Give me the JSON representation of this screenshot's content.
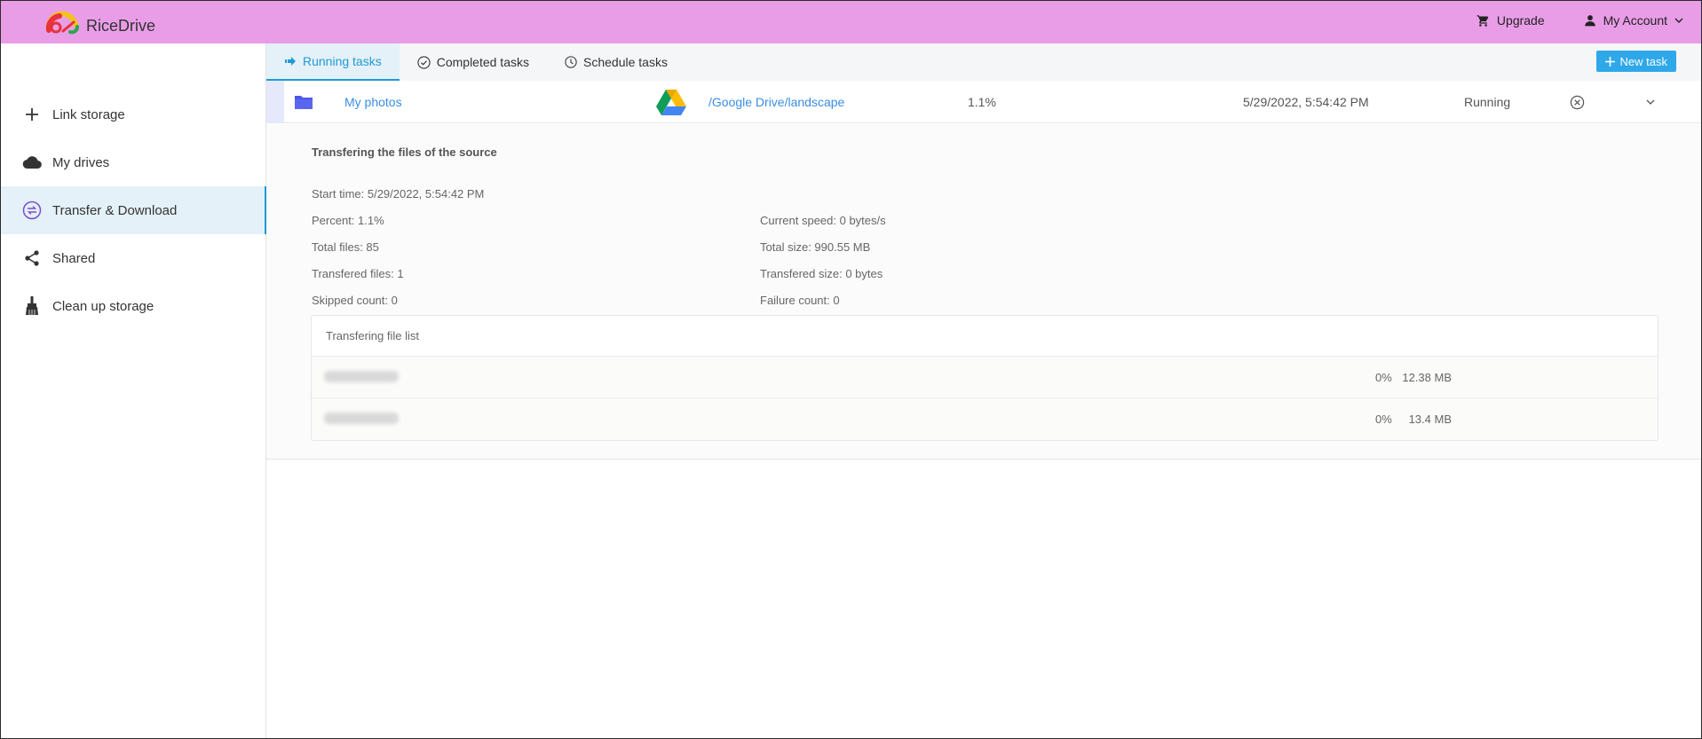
{
  "header": {
    "app_name": "RiceDrive",
    "upgrade_label": "Upgrade",
    "account_label": "My Account",
    "bg_color": "#e99de7"
  },
  "sidebar": {
    "items": [
      {
        "label": "Link storage",
        "icon": "plus-icon"
      },
      {
        "label": "My drives",
        "icon": "cloud-icon"
      },
      {
        "label": "Transfer & Download",
        "icon": "transfer-icon",
        "active": true
      },
      {
        "label": "Shared",
        "icon": "share-icon"
      },
      {
        "label": "Clean up storage",
        "icon": "broom-icon"
      }
    ]
  },
  "tabs": [
    {
      "label": "Running tasks",
      "icon": "arrow-right-icon",
      "active": true
    },
    {
      "label": "Completed tasks",
      "icon": "check-circle-icon"
    },
    {
      "label": "Schedule tasks",
      "icon": "clock-icon"
    }
  ],
  "new_task_label": "New task",
  "task": {
    "source": "My photos",
    "destination": "/Google Drive/landscape",
    "percent": "1.1%",
    "time": "5/29/2022, 5:54:42 PM",
    "status": "Running"
  },
  "details": {
    "title": "Transfering the files of the source",
    "start_time": "Start time: 5/29/2022, 5:54:42 PM",
    "percent": "Percent: 1.1%",
    "current_speed": "Current speed: 0 bytes/s",
    "total_files": "Total files: 85",
    "total_size": "Total size: 990.55 MB",
    "transfered_files": "Transfered files: 1",
    "transfered_size": "Transfered size: 0 bytes",
    "skipped_count": "Skipped count: 0",
    "failure_count": "Failure count: 0"
  },
  "file_list": {
    "title": "Transfering file list",
    "rows": [
      {
        "size": "12.38 MB",
        "percent": "0%"
      },
      {
        "size": "13.4 MB",
        "percent": "0%"
      }
    ]
  }
}
